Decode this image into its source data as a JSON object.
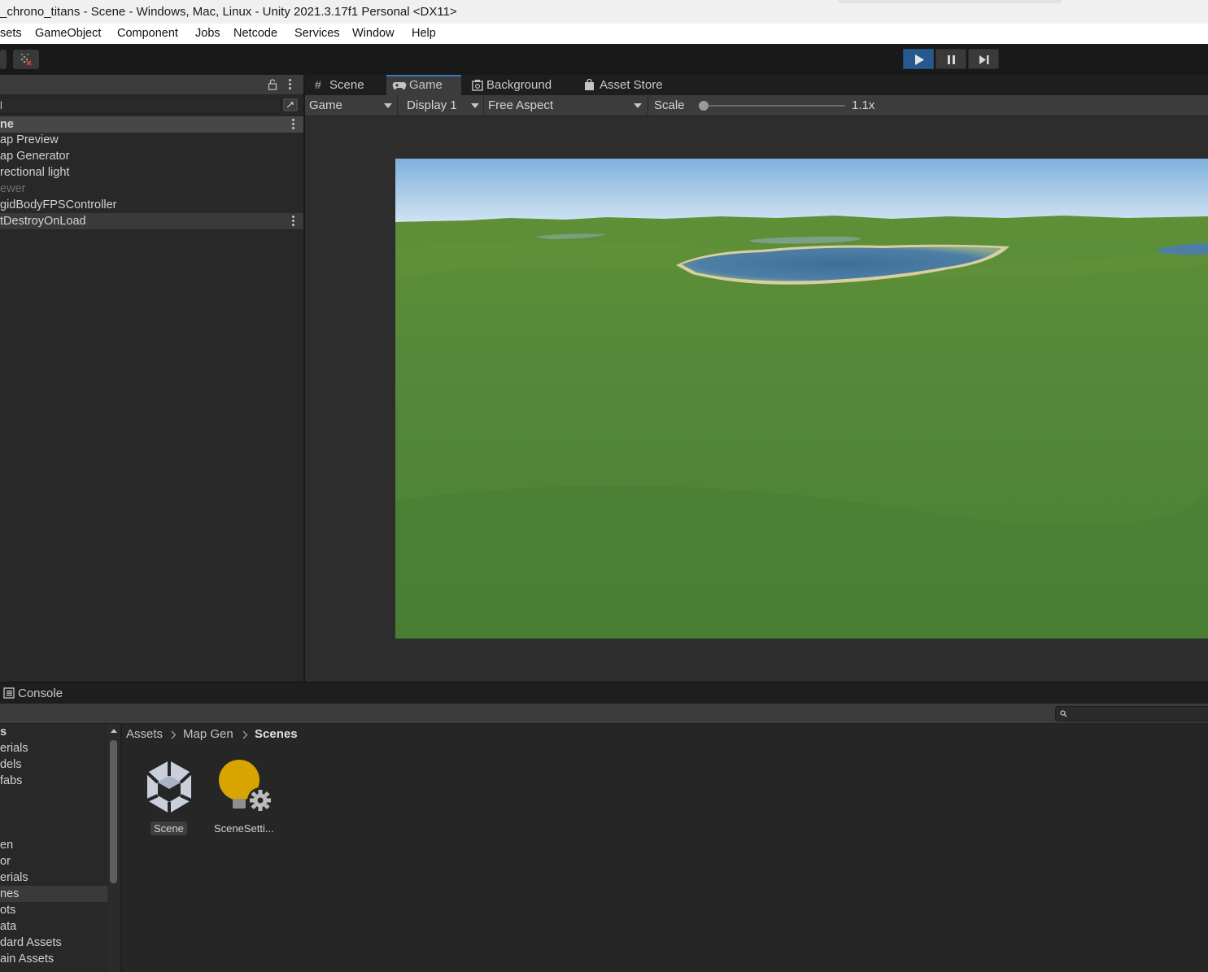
{
  "window": {
    "title": "_chrono_titans - Scene - Windows, Mac, Linux - Unity 2021.3.17f1 Personal <DX11>"
  },
  "menu": [
    "sets",
    "GameObject",
    "Component",
    "Jobs",
    "Netcode",
    "Services",
    "Window",
    "Help"
  ],
  "hierarchy": {
    "scene_name": "ne",
    "items": [
      "ap Preview",
      "ap Generator",
      "rectional light",
      "ewer",
      "gidBodyFPSController",
      "tDestroyOnLoad"
    ],
    "search_value": "l"
  },
  "game_view": {
    "tabs": [
      "Scene",
      "Game",
      "Background",
      "Asset Store"
    ],
    "active_tab": "Game",
    "game_dropdown": "Game",
    "display_dropdown": "Display 1",
    "aspect_dropdown": "Free Aspect",
    "scale_label": "Scale",
    "scale_value": "1.1x",
    "scale_fraction": 0.0
  },
  "bottom": {
    "console_tab": "Console",
    "breadcrumb": [
      "Assets",
      "Map Gen",
      "Scenes"
    ],
    "tree": [
      "s",
      "erials",
      "dels",
      "fabs",
      "",
      "",
      "",
      "en",
      "or",
      "erials",
      "nes",
      "ots",
      "ata",
      "dard Assets",
      "ain Assets"
    ],
    "selected_tree_index": 10,
    "assets": [
      {
        "label": "Scene",
        "icon": "unity-scene-icon"
      },
      {
        "label": "SceneSetti...",
        "icon": "lighting-settings-icon"
      }
    ]
  },
  "colors": {
    "accent": "#3a79bb",
    "play_active": "#27598e",
    "settings_icon": "#d9a400"
  }
}
